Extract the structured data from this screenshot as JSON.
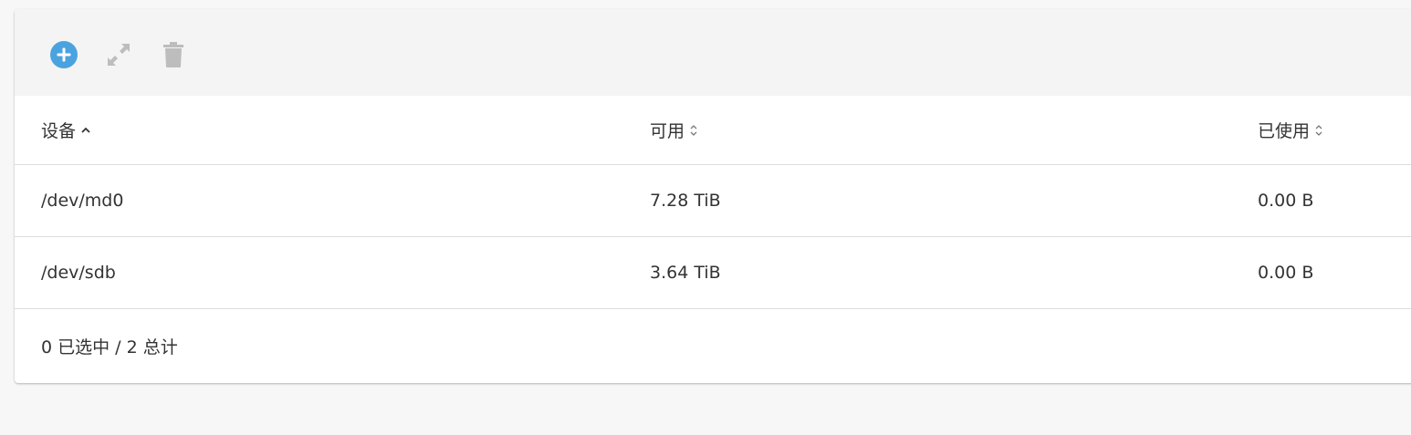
{
  "toolbar": {
    "buttons": [
      {
        "icon": "plus-circle-icon",
        "color": "#4aa3df",
        "enabled": true
      },
      {
        "icon": "expand-icon",
        "color": "#bdbdbd",
        "enabled": false
      },
      {
        "icon": "trash-icon",
        "color": "#bdbdbd",
        "enabled": false
      }
    ]
  },
  "table": {
    "columns": [
      {
        "label": "设备",
        "sort": "ascending",
        "sort_icon": "chevron-up-icon"
      },
      {
        "label": "可用",
        "sort": "none",
        "sort_icon": "sort-updown-icon"
      },
      {
        "label": "已使用",
        "sort": "none",
        "sort_icon": "sort-updown-icon"
      }
    ],
    "rows": [
      [
        "/dev/md0",
        "7.28 TiB",
        "0.00 B"
      ],
      [
        "/dev/sdb",
        "3.64 TiB",
        "0.00 B"
      ]
    ]
  },
  "footer": {
    "text": "0 已选中 / 2 总计"
  },
  "colors": {
    "accent": "#4aa3df",
    "disabled": "#bdbdbd",
    "divider": "#dcdcdc",
    "toolbar_bg": "#f4f4f4"
  }
}
